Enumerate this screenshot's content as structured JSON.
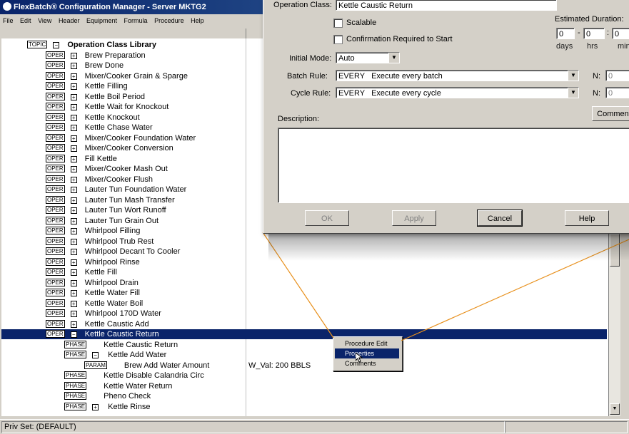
{
  "app": {
    "title": "FlexBatch® Configuration Manager - Server MKTG2",
    "menu": [
      "File",
      "Edit",
      "View",
      "Header",
      "Equipment",
      "Formula",
      "Procedure",
      "Help"
    ]
  },
  "tree": {
    "root": {
      "tag": "TOPIC",
      "expander": "−",
      "label": "Operation Class Library"
    },
    "items": [
      {
        "tag": "OPER",
        "expander": "+",
        "label": "Brew Preparation"
      },
      {
        "tag": "OPER",
        "expander": "+",
        "label": "Brew Done"
      },
      {
        "tag": "OPER",
        "expander": "+",
        "label": "Mixer/Cooker Grain & Sparge"
      },
      {
        "tag": "OPER",
        "expander": "+",
        "label": "Kettle Filling"
      },
      {
        "tag": "OPER",
        "expander": "+",
        "label": "Kettle Boil Period"
      },
      {
        "tag": "OPER",
        "expander": "+",
        "label": "Kettle Wait for Knockout"
      },
      {
        "tag": "OPER",
        "expander": "+",
        "label": "Kettle Knockout"
      },
      {
        "tag": "OPER",
        "expander": "+",
        "label": "Kettle Chase Water"
      },
      {
        "tag": "OPER",
        "expander": "+",
        "label": "Mixer/Cooker Foundation Water"
      },
      {
        "tag": "OPER",
        "expander": "+",
        "label": "Mixer/Cooker Conversion"
      },
      {
        "tag": "OPER",
        "expander": "+",
        "label": "Fill Kettle"
      },
      {
        "tag": "OPER",
        "expander": "+",
        "label": "Mixer/Cooker Mash Out"
      },
      {
        "tag": "OPER",
        "expander": "+",
        "label": "Mixer/Cooker Flush"
      },
      {
        "tag": "OPER",
        "expander": "+",
        "label": "Lauter Tun Foundation Water"
      },
      {
        "tag": "OPER",
        "expander": "+",
        "label": "Lauter Tun Mash Transfer"
      },
      {
        "tag": "OPER",
        "expander": "+",
        "label": "Lauter Tun Wort Runoff"
      },
      {
        "tag": "OPER",
        "expander": "+",
        "label": "Lauter Tun Grain Out"
      },
      {
        "tag": "OPER",
        "expander": "+",
        "label": "Whirlpool Filling"
      },
      {
        "tag": "OPER",
        "expander": "+",
        "label": "Whirlpool Trub Rest"
      },
      {
        "tag": "OPER",
        "expander": "+",
        "label": "Whirlpool Decant To Cooler"
      },
      {
        "tag": "OPER",
        "expander": "+",
        "label": "Whirlpool Rinse"
      },
      {
        "tag": "OPER",
        "expander": "+",
        "label": "Kettle Fill"
      },
      {
        "tag": "OPER",
        "expander": "+",
        "label": "Whirlpool Drain"
      },
      {
        "tag": "OPER",
        "expander": "+",
        "label": "Kettle Water Fill"
      },
      {
        "tag": "OPER",
        "expander": "+",
        "label": "Kettle Water Boil"
      },
      {
        "tag": "OPER",
        "expander": "+",
        "label": "Whirlpool 170D Water"
      },
      {
        "tag": "OPER",
        "expander": "+",
        "label": "Kettle Caustic Add"
      },
      {
        "tag": "OPER",
        "expander": "−",
        "label": "Kettle Caustic Return"
      }
    ],
    "children": [
      {
        "tag": "PHASE",
        "expander": "",
        "label": "Kettle Caustic Return",
        "value": ""
      },
      {
        "tag": "PHASE",
        "expander": "−",
        "label": "Kettle Add Water",
        "value": ""
      },
      {
        "tag": "PARAM",
        "expander": "",
        "label": "Brew Add Water Amount",
        "value": "W_Val: 200  BBLS"
      },
      {
        "tag": "PHASE",
        "expander": "",
        "label": "Kettle Disable Calandria Circ",
        "value": ""
      },
      {
        "tag": "PHASE",
        "expander": "",
        "label": "Kettle Water Return",
        "value": ""
      },
      {
        "tag": "PHASE",
        "expander": "",
        "label": "Pheno Check",
        "value": ""
      },
      {
        "tag": "PHASE",
        "expander": "+",
        "label": "Kettle Rinse",
        "value": ""
      }
    ]
  },
  "status": {
    "priv_set": "Priv Set: (DEFAULT)"
  },
  "dialog": {
    "operation_class_label": "Operation Class:",
    "operation_class_value": "Kettle Caustic Return",
    "scalable_label": "Scalable",
    "confirmation_label": "Confirmation Required to Start",
    "estimated_duration_label": "Estimated Duration:",
    "days_value": "0",
    "hrs_value": "0",
    "min_value": "0",
    "days_label": "days",
    "hrs_label": "hrs",
    "min_label": "min",
    "sep1": "-",
    "sep2": ":",
    "initial_mode_label": "Initial Mode:",
    "initial_mode_value": "Auto",
    "batch_rule_label": "Batch Rule:",
    "batch_rule_value": "EVERY   Execute every batch",
    "cycle_rule_label": "Cycle Rule:",
    "cycle_rule_value": "EVERY   Execute every cycle",
    "n_label": "N:",
    "batch_n_value": "0",
    "cycle_n_value": "0",
    "comment_button": "Comment",
    "description_label": "Description:",
    "ok_button": "OK",
    "apply_button": "Apply",
    "cancel_button": "Cancel",
    "help_button": "Help"
  },
  "context_menu": {
    "items": [
      "Procedure Edit",
      "Properties",
      "Comments"
    ],
    "highlighted": "Properties"
  },
  "colors": {
    "selection": "#0a246a",
    "callout_line": "#e8901c",
    "window_face": "#d4d0c8"
  }
}
